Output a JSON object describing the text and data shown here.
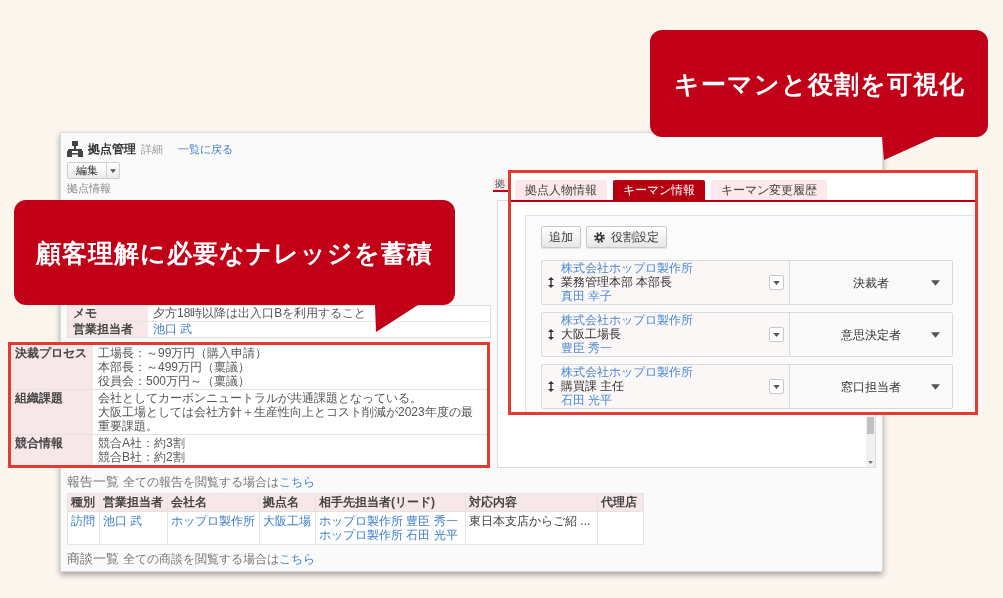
{
  "callouts": [
    {
      "text": "キーマンと役割を可視化"
    },
    {
      "text": "顧客理解に必要なナレッジを蓄積"
    }
  ],
  "app": {
    "title": "拠点管理",
    "subtitle": "詳細",
    "back_link": "一覧に戻る",
    "edit_button": "編集",
    "section_title": "拠点情報",
    "info_rows": [
      {
        "label": "メモ",
        "value": "夕方18時以降は出入口Bを利用すること",
        "kind": "text"
      },
      {
        "label": "営業担当者",
        "value": "池口 武",
        "kind": "link"
      }
    ],
    "reports": {
      "title": "報告一覧",
      "note": "全ての報告を閲覧する場合は",
      "link": "こちら",
      "columns": [
        "種別",
        "営業担当者",
        "会社名",
        "拠点名",
        "相手先担当者(リード)",
        "対応内容",
        "代理店"
      ],
      "rows": [
        {
          "cells": [
            {
              "kind": "link",
              "lines": [
                "訪問"
              ]
            },
            {
              "kind": "link",
              "lines": [
                "池口 武"
              ]
            },
            {
              "kind": "link",
              "lines": [
                "ホップロ製作所"
              ]
            },
            {
              "kind": "link",
              "lines": [
                "大阪工場"
              ]
            },
            {
              "kind": "link",
              "lines": [
                "ホップロ製作所 豊臣 秀一",
                "ホップロ製作所 石田 光平"
              ]
            },
            {
              "kind": "text",
              "lines": [
                "東日本支店からご紹 ..."
              ]
            }
          ]
        }
      ]
    },
    "deals": {
      "title": "商談一覧",
      "note": "全ての商談を閲覧する場合は",
      "link": "こちら"
    },
    "side_tabs": [
      {
        "label": "拠",
        "selected": false
      }
    ]
  },
  "highlight": {
    "rows": [
      {
        "label": "決裁プロセス",
        "lines": [
          "工場長：～99万円（購入申請）",
          "本部長：～499万円（稟議）",
          "役員会：500万円～（稟議）"
        ]
      },
      {
        "label": "組織課題",
        "lines": [
          "会社としてカーボンニュートラルが共通課題となっている。",
          "大阪工場としては会社方針＋生産性向上とコスト削減が2023年度の最重要課題。"
        ]
      },
      {
        "label": "競合情報",
        "lines": [
          "競合A社：約3割",
          "競合B社：約2割"
        ]
      }
    ]
  },
  "keyman_panel": {
    "tabs": [
      {
        "label": "拠点人物情報",
        "selected": false
      },
      {
        "label": "キーマン情報",
        "selected": true
      },
      {
        "label": "キーマン変更履歴",
        "selected": false
      }
    ],
    "buttons": [
      {
        "label": "追加",
        "kind": "add"
      },
      {
        "label": "役割設定",
        "kind": "settings"
      }
    ],
    "keymen": [
      {
        "company": "株式会社ホップロ製作所",
        "title": "業務管理本部 本部長",
        "name": "真田 幸子",
        "role": "決裁者"
      },
      {
        "company": "株式会社ホップロ製作所",
        "title": "大阪工場長",
        "name": "豊臣 秀一",
        "role": "意思決定者"
      },
      {
        "company": "株式会社ホップロ製作所",
        "title": "購買課 主任",
        "name": "石田 光平",
        "role": "窓口担当者"
      }
    ]
  }
}
